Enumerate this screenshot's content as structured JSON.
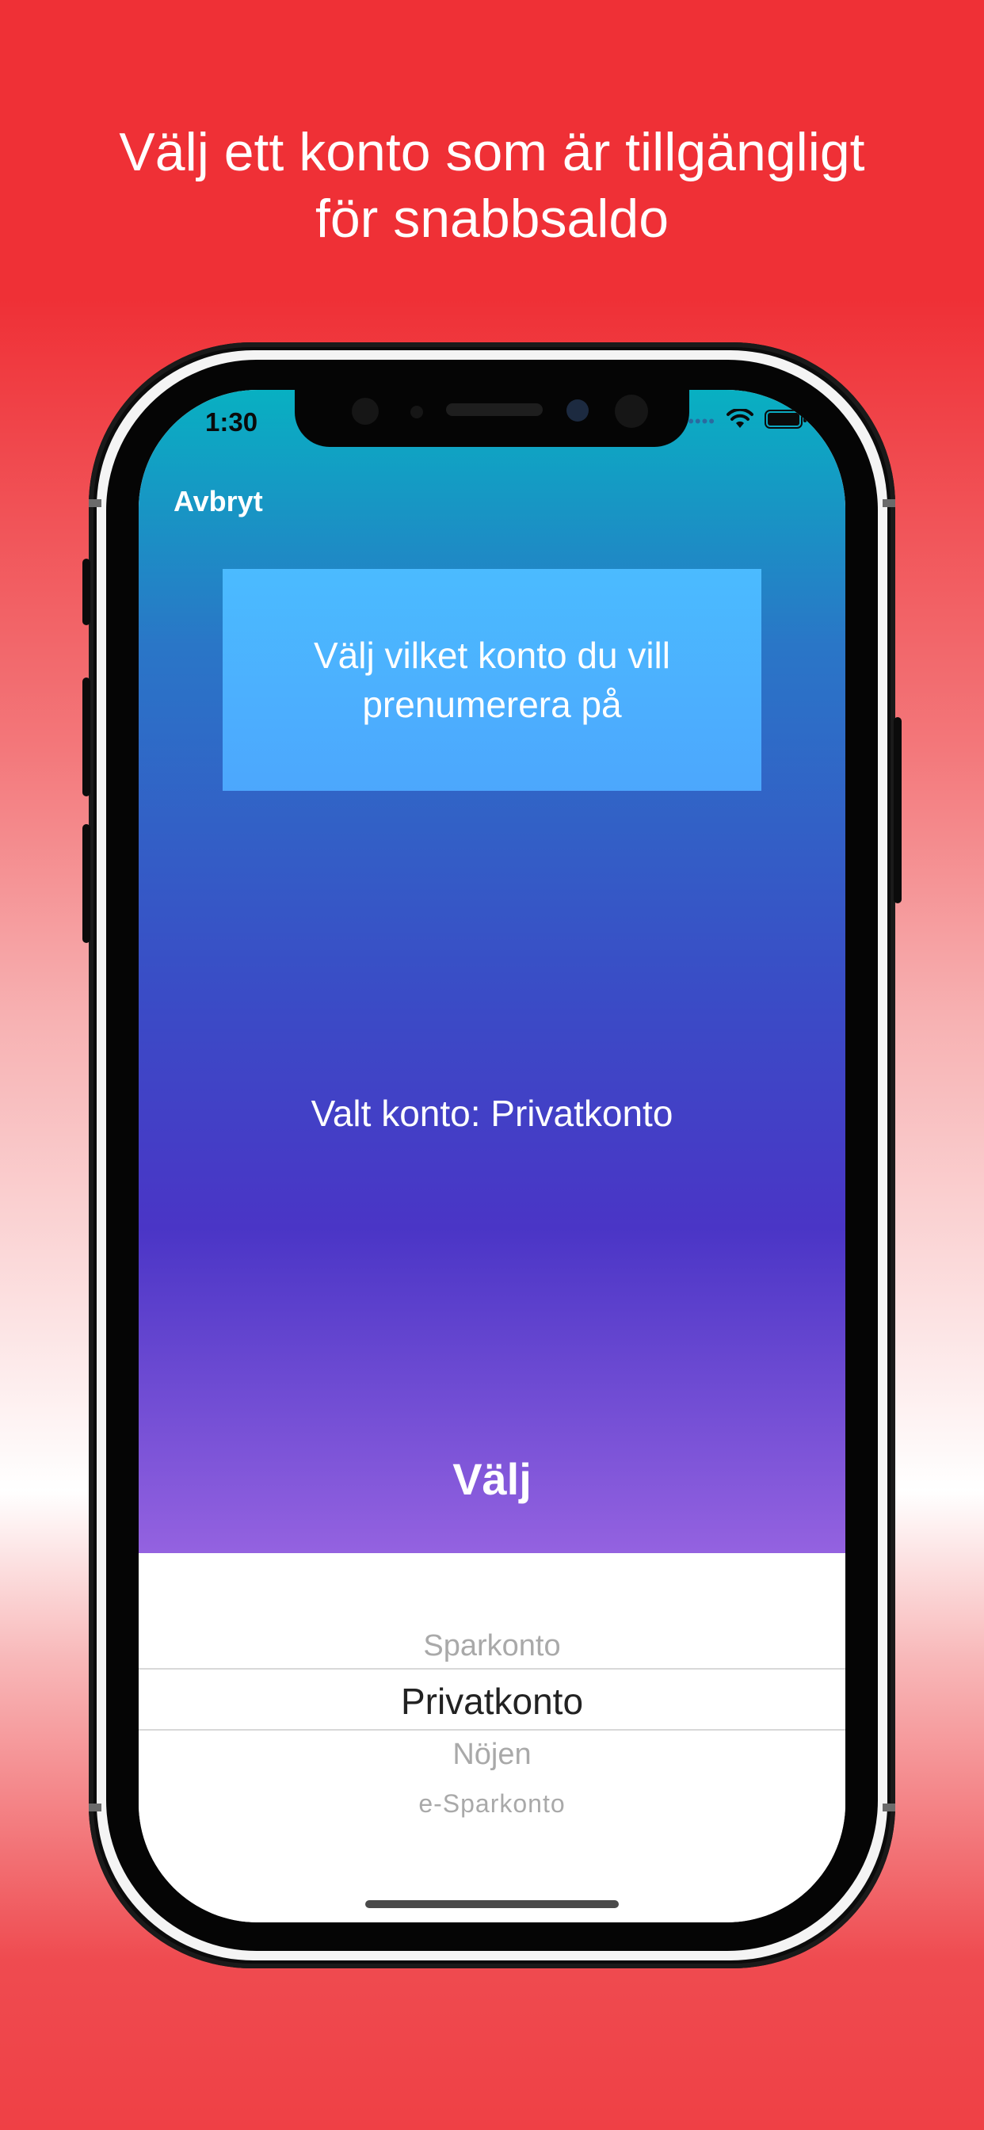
{
  "promo": {
    "headline_line1": "Välj ett konto som är tillgängligt",
    "headline_line2": "för snabbsaldo"
  },
  "status_bar": {
    "time": "1:30",
    "icons": [
      "signal-dots-icon",
      "wifi-icon",
      "battery-icon"
    ]
  },
  "nav": {
    "cancel_label": "Avbryt"
  },
  "main": {
    "info_text": "Välj vilket konto du vill prenumerera på",
    "selected_account_text": "Valt konto: Privatkonto",
    "choose_label": "Välj"
  },
  "picker": {
    "items": [
      "Sparkonto",
      "Privatkonto",
      "Nöjen",
      "e-Sparkonto"
    ],
    "selected": "Privatkonto"
  },
  "colors": {
    "background_red": "#ef3036",
    "gradient_top": "#08b0c2",
    "gradient_mid": "#4a35c6",
    "gradient_bottom": "#9462e0",
    "info_box": "#4bb3fe"
  }
}
